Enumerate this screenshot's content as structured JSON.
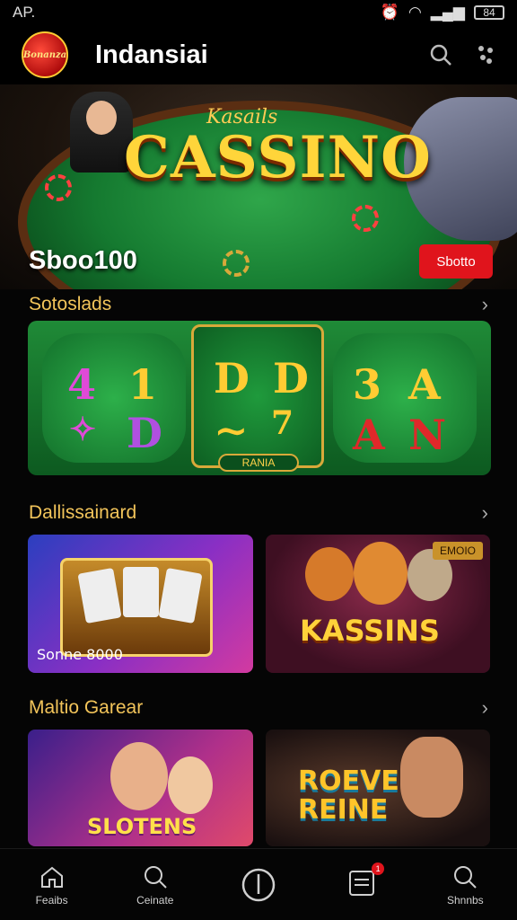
{
  "status_bar": {
    "left": "AP.",
    "battery": "84"
  },
  "app": {
    "title": "Indansiai",
    "logo_text": "Bonanza"
  },
  "hero": {
    "subtitle": "Kasails",
    "title": "CASSINO",
    "amount": "Sboo100",
    "button_label": "Sbotto"
  },
  "sections": [
    {
      "title": "Sotoslads"
    },
    {
      "title": "Dallissainard"
    },
    {
      "title": "Maltio Garear"
    }
  ],
  "slot_reels": {
    "left": [
      "4",
      "1",
      "✧",
      "D"
    ],
    "middle": [
      "D",
      "D",
      "∼",
      "7"
    ],
    "right": [
      "3",
      "A",
      "A",
      "N"
    ],
    "label": "RANIA"
  },
  "cards": [
    {
      "caption": "Sonne 8000",
      "tag": ""
    },
    {
      "caption": "KASSINS",
      "tag": "EMOIO"
    },
    {
      "caption": "SLOTENS",
      "tag": ""
    },
    {
      "caption": "ROEVE REINE",
      "tag": ""
    }
  ],
  "bottom_nav": [
    {
      "label": "Feaibs",
      "icon": "home-icon"
    },
    {
      "label": "Ceinate",
      "icon": "search-icon"
    },
    {
      "label": "",
      "icon": "power-icon"
    },
    {
      "label": "",
      "icon": "inbox-icon",
      "badge": "1"
    },
    {
      "label": "Shnnbs",
      "icon": "search-icon"
    }
  ],
  "colors": {
    "accent": "#e0141c",
    "section_title": "#f2c45a",
    "felt": "#1f8a37"
  }
}
